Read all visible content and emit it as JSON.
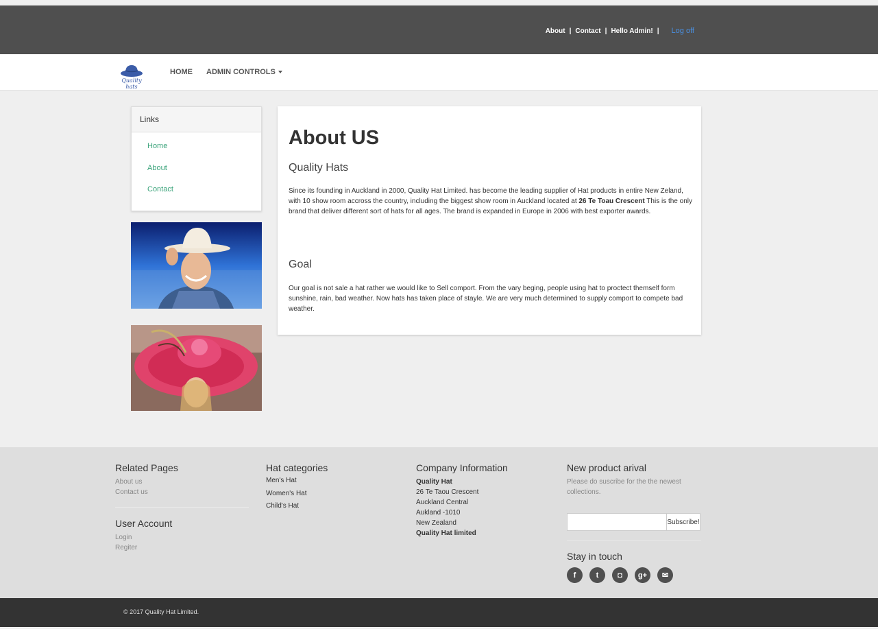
{
  "topbar": {
    "about": "About",
    "contact": "Contact",
    "greeting": "Hello Admin!",
    "logoff": "Log off",
    "separator": "|"
  },
  "brand": {
    "logo_text": "Quality hats"
  },
  "nav": {
    "home": "HOME",
    "admin": "ADMIN CONTROLS"
  },
  "sidebar": {
    "title": "Links",
    "links": [
      "Home",
      "About",
      "Contact"
    ]
  },
  "main": {
    "title": "About US",
    "section1_heading": "Quality Hats",
    "section1_text_a": "Since its founding in Auckland in 2000, Quality Hat Limited. has become the leading supplier of Hat products in entire New Zeland, with 10 show room accross the country, including the biggest show room in Auckland located at ",
    "section1_text_bold": "26 Te Toau Crescent",
    "section1_text_b": " This is the only brand that deliver different sort of hats for all ages. The brand is expanded in Europe in 2006 with best exporter awards.",
    "section2_heading": "Goal",
    "section2_text": "Our goal is not sale a hat rather we would like to Sell comport. From the vary beging, people using hat to proctect themself form sunshine, rain, bad weather. Now hats has taken place of stayle. We are very much determined to supply comport to compete bad weather."
  },
  "footer": {
    "related": {
      "heading": "Related Pages",
      "items": [
        "About us",
        "Contact us"
      ]
    },
    "account": {
      "heading": "User Account",
      "items": [
        "Login",
        "Regiter"
      ]
    },
    "categories": {
      "heading": "Hat categories",
      "items": [
        "Men's Hat",
        "Women's Hat",
        "Child's Hat"
      ]
    },
    "company": {
      "heading": "Company Information",
      "name": "Quality Hat",
      "address": [
        "26 Te Taou Crescent",
        "Auckland Central",
        "Aukland -1010",
        "New Zealand"
      ],
      "legal": "Quality Hat limited"
    },
    "newproduct": {
      "heading": "New product arival",
      "text": "Please do suscribe for the the newest collections.",
      "email_placeholder": "",
      "subscribe_label": "Subscribe!"
    },
    "social": {
      "heading": "Stay in touch",
      "icons": [
        "facebook-icon",
        "twitter-icon",
        "instagram-icon",
        "google-plus-icon",
        "email-icon"
      ],
      "glyphs": [
        "f",
        "t",
        "◘",
        "g+",
        "✉"
      ]
    }
  },
  "copyright": "© 2017 Quality Hat Limited."
}
